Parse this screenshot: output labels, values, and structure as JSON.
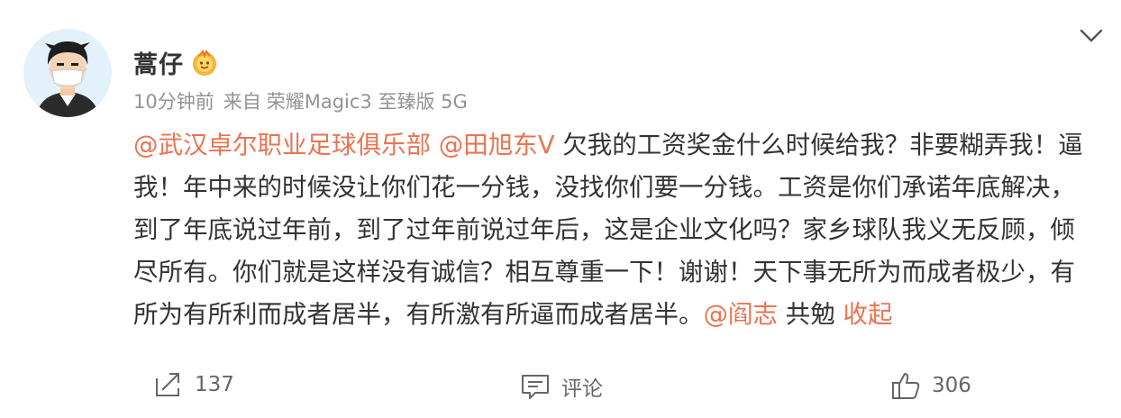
{
  "post": {
    "author": "蒿仔",
    "time": "10分钟前",
    "source_prefix": "来自",
    "device": "荣耀Magic3 至臻版 5G",
    "mention_club": "@武汉卓尔职业足球俱乐部",
    "mention_person": "@田旭东V",
    "line1_text": " 欠我的工资奖金什么时候给我？非要糊弄我！逼",
    "line2_text": "我！年中来的时候没让你们花一分钱，没找你们要一分钱。工资是你们承诺年底解决，",
    "line3_text": "到了年底说过年前，到了过年前说过年后，这是企业文化吗？家乡球队我义无反顾，倾",
    "line4_text": "尽所有。你们就是这样没有诚信？相互尊重一下！谢谢！天下事无所为而成者极少，有",
    "line5_text": "所为有所利而成者居半，有所激有所逼而成者居半。",
    "mention_last": "@阎志",
    "closing": " 共勉 ",
    "collapse": "收起"
  },
  "actions": {
    "repost_count": "137",
    "comment_label": "评论",
    "like_count": "306"
  },
  "icons": {
    "chevron": "chevron-down-icon",
    "repost": "repost-icon",
    "comment": "comment-icon",
    "like": "thumbs-up-icon",
    "badge": "user-badge-icon"
  },
  "colors": {
    "link": "#eb7350",
    "meta": "#939393",
    "text": "#333333"
  }
}
